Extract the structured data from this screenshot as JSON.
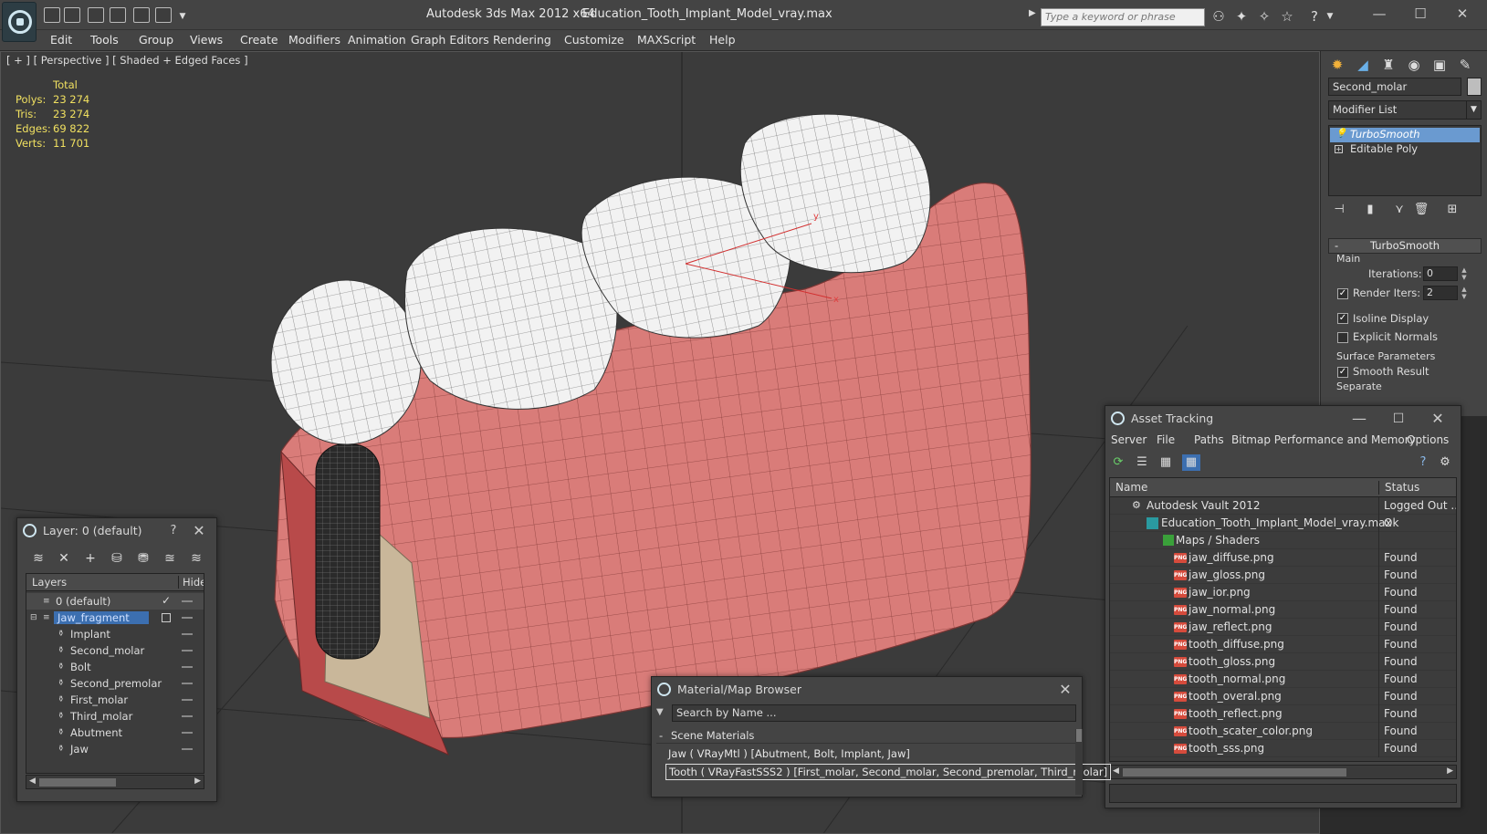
{
  "titlebar": {
    "app_title": "Autodesk 3ds Max  2012 x64",
    "file_title": "Education_Tooth_Implant_Model_vray.max",
    "search_placeholder": "Type a keyword or phrase"
  },
  "menu": [
    "Edit",
    "Tools",
    "Group",
    "Views",
    "Create",
    "Modifiers",
    "Animation",
    "Graph Editors",
    "Rendering",
    "Customize",
    "MAXScript",
    "Help"
  ],
  "viewport": {
    "label": "[ + ] [ Perspective ] [ Shaded + Edged Faces ]",
    "stats": {
      "header": "Total",
      "rows": [
        {
          "label": "Polys:",
          "value": "23 274"
        },
        {
          "label": "Tris:",
          "value": "23 274"
        },
        {
          "label": "Edges:",
          "value": "69 822"
        },
        {
          "label": "Verts:",
          "value": "11 701"
        }
      ]
    },
    "gizmo": {
      "y_label": "y",
      "x_label": "x"
    }
  },
  "command_panel": {
    "object_name": "Second_molar",
    "modifier_list": "Modifier List",
    "stack": [
      "TurboSmooth",
      "Editable Poly"
    ],
    "rollout_title": "TurboSmooth",
    "main_group": "Main",
    "iterations_label": "Iterations:",
    "iterations_value": "0",
    "render_iters_label": "Render Iters:",
    "render_iters_value": "2",
    "isoline_label": "Isoline Display",
    "explicit_label": "Explicit Normals",
    "surface_group": "Surface Parameters",
    "smooth_result_label": "Smooth Result",
    "separate_label": "Separate"
  },
  "layer_window": {
    "title": "Layer: 0 (default)",
    "help": "?",
    "col_layers": "Layers",
    "col_hide": "Hide",
    "rows": [
      {
        "name": "0 (default)",
        "level": 0,
        "checked": true
      },
      {
        "name": "Jaw_fragment",
        "level": 0,
        "active": true
      },
      {
        "name": "Implant",
        "level": 1
      },
      {
        "name": "Second_molar",
        "level": 1
      },
      {
        "name": "Bolt",
        "level": 1
      },
      {
        "name": "Second_premolar",
        "level": 1
      },
      {
        "name": "First_molar",
        "level": 1
      },
      {
        "name": "Third_molar",
        "level": 1
      },
      {
        "name": "Abutment",
        "level": 1
      },
      {
        "name": "Jaw",
        "level": 1
      }
    ]
  },
  "asset_tracking": {
    "title": "Asset Tracking",
    "menu": [
      "Server",
      "File",
      "Paths",
      "Bitmap Performance and Memory",
      "Options"
    ],
    "col_name": "Name",
    "col_status": "Status",
    "rows": [
      {
        "name": "Autodesk Vault 2012",
        "status": "Logged Out ...",
        "level": 0,
        "icon": "vault"
      },
      {
        "name": "Education_Tooth_Implant_Model_vray.max",
        "status": "Ok",
        "level": 1,
        "icon": "max"
      },
      {
        "name": "Maps / Shaders",
        "status": "",
        "level": 2,
        "icon": "folder"
      },
      {
        "name": "jaw_diffuse.png",
        "status": "Found",
        "level": 3,
        "icon": "png"
      },
      {
        "name": "jaw_gloss.png",
        "status": "Found",
        "level": 3,
        "icon": "png"
      },
      {
        "name": "jaw_ior.png",
        "status": "Found",
        "level": 3,
        "icon": "png"
      },
      {
        "name": "jaw_normal.png",
        "status": "Found",
        "level": 3,
        "icon": "png"
      },
      {
        "name": "jaw_reflect.png",
        "status": "Found",
        "level": 3,
        "icon": "png"
      },
      {
        "name": "tooth_diffuse.png",
        "status": "Found",
        "level": 3,
        "icon": "png"
      },
      {
        "name": "tooth_gloss.png",
        "status": "Found",
        "level": 3,
        "icon": "png"
      },
      {
        "name": "tooth_normal.png",
        "status": "Found",
        "level": 3,
        "icon": "png"
      },
      {
        "name": "tooth_overal.png",
        "status": "Found",
        "level": 3,
        "icon": "png"
      },
      {
        "name": "tooth_reflect.png",
        "status": "Found",
        "level": 3,
        "icon": "png"
      },
      {
        "name": "tooth_scater_color.png",
        "status": "Found",
        "level": 3,
        "icon": "png"
      },
      {
        "name": "tooth_sss.png",
        "status": "Found",
        "level": 3,
        "icon": "png"
      }
    ],
    "png_badge": "PNG"
  },
  "material_browser": {
    "title": "Material/Map Browser",
    "search_placeholder": "Search by Name ...",
    "group": "Scene Materials",
    "rows": [
      {
        "text": "Jaw  ( VRayMtl )  [Abutment, Bolt, Implant, Jaw]",
        "selected": false
      },
      {
        "text": "Tooth  ( VRayFastSSS2 )  [First_molar, Second_molar, Second_premolar, Third_molar]",
        "selected": true
      }
    ]
  },
  "colors": {
    "gum": "#d97c79",
    "tooth": "#f4f4f4",
    "stats_text": "#f0e060",
    "selection": "#6a9ad0"
  }
}
